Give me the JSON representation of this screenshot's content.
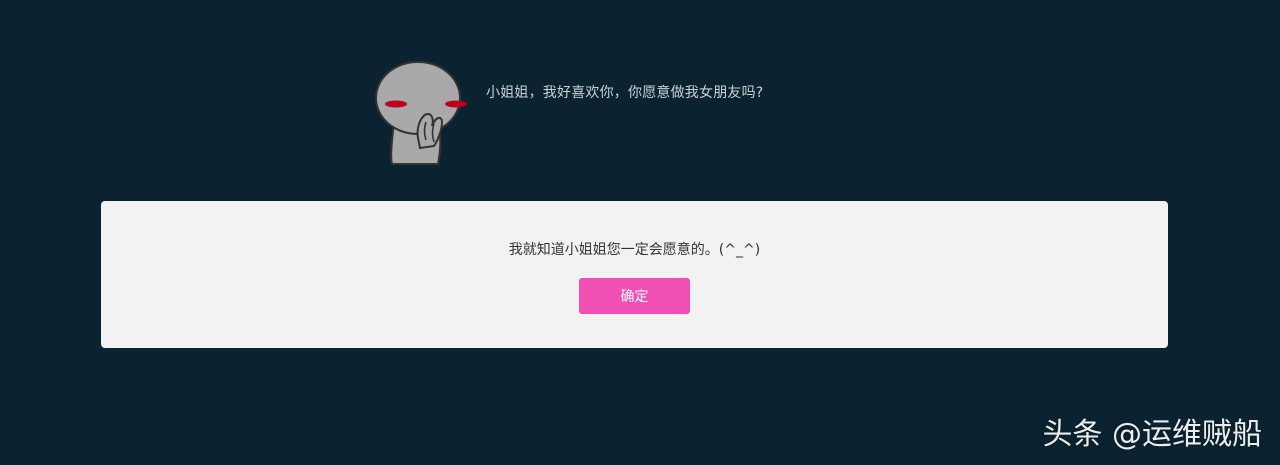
{
  "question": {
    "text": "小姐姐，我好喜欢你，你愿意做我女朋友吗?"
  },
  "character": {
    "icon": "shy-stickman-icon"
  },
  "dialog": {
    "message": "我就知道小姐姐您一定会愿意的。(^_^)",
    "confirm_label": "确定"
  },
  "watermark": {
    "text": "头条 @运维贼船"
  },
  "colors": {
    "background": "#0b2330",
    "dialog_bg": "#f2f2f2",
    "button_bg": "#f050b4",
    "blush": "#c0001a"
  }
}
